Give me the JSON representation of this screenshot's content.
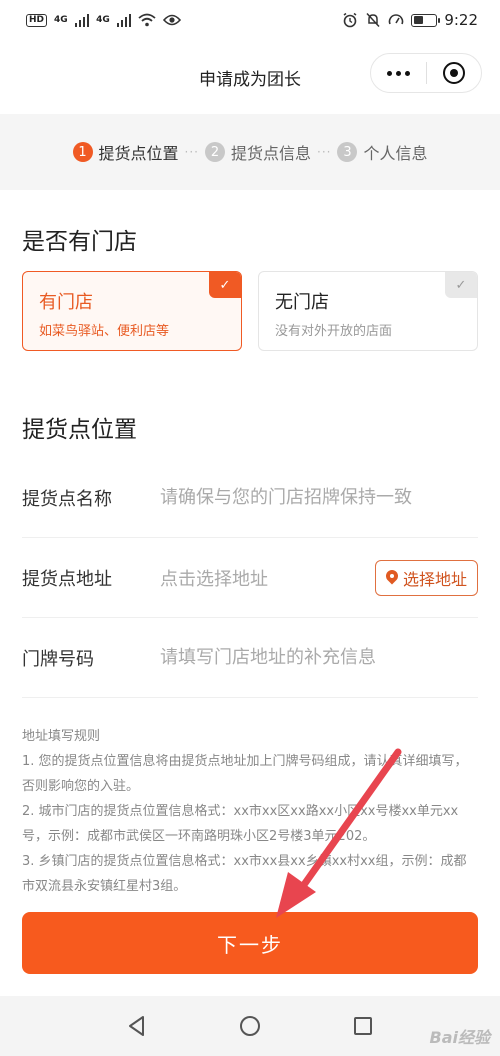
{
  "status_bar": {
    "left_badges": [
      "HD",
      "4G",
      "4G"
    ],
    "time": "9:22"
  },
  "header": {
    "title": "申请成为团长"
  },
  "steps": [
    {
      "num": "1",
      "label": "提货点位置"
    },
    {
      "num": "2",
      "label": "提货点信息"
    },
    {
      "num": "3",
      "label": "个人信息"
    }
  ],
  "step_separator": "···",
  "store_section": {
    "title": "是否有门店",
    "options": [
      {
        "title": "有门店",
        "subtitle": "如菜鸟驿站、便利店等",
        "selected": true
      },
      {
        "title": "无门店",
        "subtitle": "没有对外开放的店面",
        "selected": false
      }
    ]
  },
  "location_section": {
    "title": "提货点位置",
    "name_field": {
      "label": "提货点名称",
      "placeholder": "请确保与您的门店招牌保持一致"
    },
    "address_field": {
      "label": "提货点地址",
      "placeholder": "点击选择地址",
      "button_label": "选择地址"
    },
    "door_field": {
      "label": "门牌号码",
      "placeholder": "请填写门店地址的补充信息"
    }
  },
  "rules": {
    "title": "地址填写规则",
    "items": [
      "1. 您的提货点位置信息将由提货点地址加上门牌号码组成，请认真详细填写，否则影响您的入驻。",
      "2. 城市门店的提货点位置信息格式：xx市xx区xx路xx小区xx号楼xx单元xx号，示例：成都市武侯区一环南路明珠小区2号楼3单元202。",
      "3. 乡镇门店的提货点位置信息格式：xx市xx县xx乡镇xx村xx组，示例：成都市双流县永安镇红星村3组。"
    ]
  },
  "next_button": {
    "label": "下一步"
  },
  "watermark": "Bai经验",
  "colors": {
    "accent": "#f75a1e",
    "annotation_arrow": "#e8454f"
  }
}
